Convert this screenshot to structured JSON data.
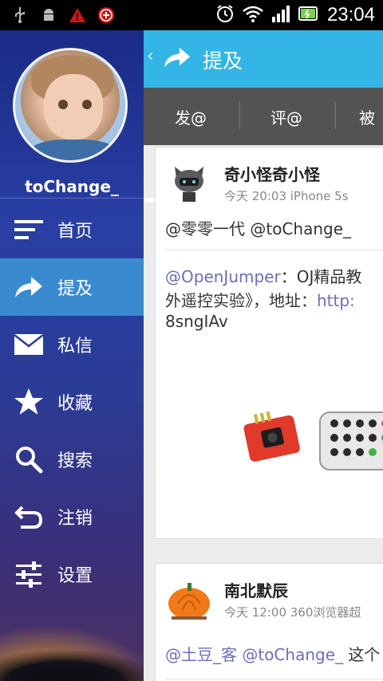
{
  "status": {
    "time": "23:04"
  },
  "drawer": {
    "username": "toChange_",
    "menu": [
      {
        "label": "首页",
        "icon": "menu-lines-icon"
      },
      {
        "label": "提及",
        "icon": "share-arrow-icon"
      },
      {
        "label": "私信",
        "icon": "envelope-icon"
      },
      {
        "label": "收藏",
        "icon": "star-icon"
      },
      {
        "label": "搜索",
        "icon": "search-icon"
      },
      {
        "label": "注销",
        "icon": "undo-icon"
      },
      {
        "label": "设置",
        "icon": "sliders-icon"
      }
    ],
    "active_index": 1
  },
  "header": {
    "title": "提及"
  },
  "tabs": [
    "发@",
    "评@",
    "被"
  ],
  "posts": [
    {
      "nick": "奇小怪奇小怪",
      "meta": "今天 20:03  iPhone 5s",
      "mentions": "@零零一代 @toChange_",
      "body_mention": "@OpenJumper",
      "body_text": "：OJ精品教",
      "body_line2": "外遥控实验》，地址：",
      "body_link": "http:",
      "body_line3": "8sngIAv"
    },
    {
      "nick": "南北默辰",
      "meta": "今天 12:00  360浏览器超",
      "mentions": "@土豆_客 @toChange_",
      "tail": " 这个"
    }
  ],
  "colors": {
    "accent": "#33b5e5",
    "tab_bg": "#535353",
    "mention": "#6b6fb5",
    "active_menu": "#3a8ad0"
  }
}
